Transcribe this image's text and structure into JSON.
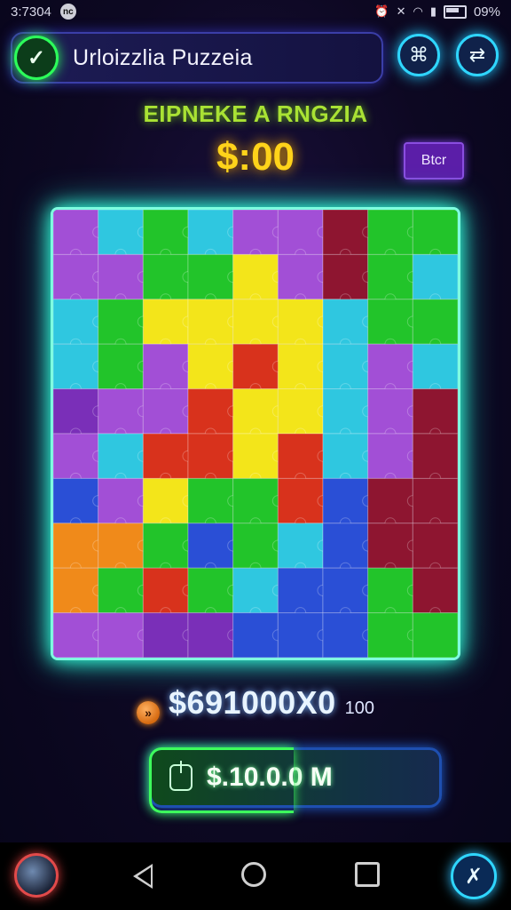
{
  "status_bar": {
    "time": "3:7304",
    "badge": "nc",
    "battery_text": "09%",
    "icons": [
      "alarm-icon",
      "mute-icon",
      "wifi-icon",
      "signal-icon",
      "battery-icon"
    ]
  },
  "header": {
    "title": "Urloizzlia Puzzeia",
    "check_icon": "check-icon",
    "share_icon": "share-icon",
    "menu_icon": "puzzle-settings-icon"
  },
  "game": {
    "subtitle": "EIPNEKE A RNGZIA",
    "timer": "$:00",
    "side_button_label": "Btcr"
  },
  "puzzle": {
    "grid_cols": 9,
    "grid_rows": 10,
    "colors": {
      "purple": "#a24fd6",
      "violet": "#7a2fb8",
      "green": "#22c42a",
      "cyan": "#2fc7e0",
      "yellow": "#f3e51a",
      "red": "#d8321c",
      "orange": "#f08a1a",
      "blue": "#2a4fd6",
      "maroon": "#8e1530",
      "teal": "#159aa8"
    }
  },
  "score": {
    "coin_icon": "coin-icon",
    "value": "$691000X0",
    "sub": "100"
  },
  "action": {
    "icon": "timer-icon",
    "label": "$.10.0.0 M"
  },
  "nav": {
    "orb_icon": "profile-orb-icon",
    "back_icon": "back-icon",
    "home_icon": "home-icon",
    "recent_icon": "recent-apps-icon",
    "assist_icon": "assistant-icon"
  }
}
